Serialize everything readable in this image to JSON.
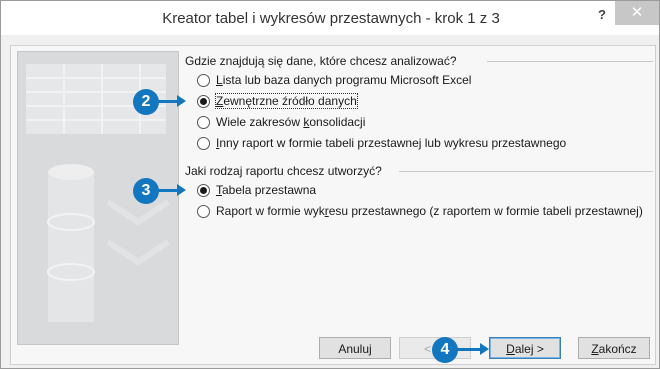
{
  "window": {
    "title": "Kreator tabel i wykresów przestawnych - krok 1 z 3",
    "help_label": "?",
    "close_label": "✕"
  },
  "source_group": {
    "label": "Gdzie znajdują się dane, które chcesz analizować?",
    "options": [
      {
        "access_key": "L",
        "rest": "ista lub baza danych programu Microsoft Excel",
        "selected": false
      },
      {
        "access_key": "Z",
        "rest": "ewnętrzne źródło danych",
        "selected": true
      },
      {
        "pre": "Wiele zakresów ",
        "access_key": "k",
        "rest": "onsolidacji",
        "selected": false
      },
      {
        "access_key": "I",
        "rest": "nny raport w formie tabeli przestawnej lub wykresu przestawnego",
        "selected": false
      }
    ]
  },
  "report_group": {
    "label": "Jaki rodzaj raportu chcesz utworzyć?",
    "options": [
      {
        "access_key": "T",
        "rest": "abela przestawna",
        "selected": true
      },
      {
        "pre": "Raport w formie wyk",
        "access_key": "r",
        "rest": "esu przestawnego (z raportem w formie tabeli przestawnej)",
        "selected": false
      }
    ]
  },
  "buttons": {
    "cancel": "Anuluj",
    "back": "< W",
    "next_key": "D",
    "next_rest": "alej >",
    "finish_key": "Z",
    "finish_rest": "akończ"
  },
  "callouts": [
    "2",
    "3",
    "4"
  ],
  "colors": {
    "callout": "#1277bf"
  }
}
